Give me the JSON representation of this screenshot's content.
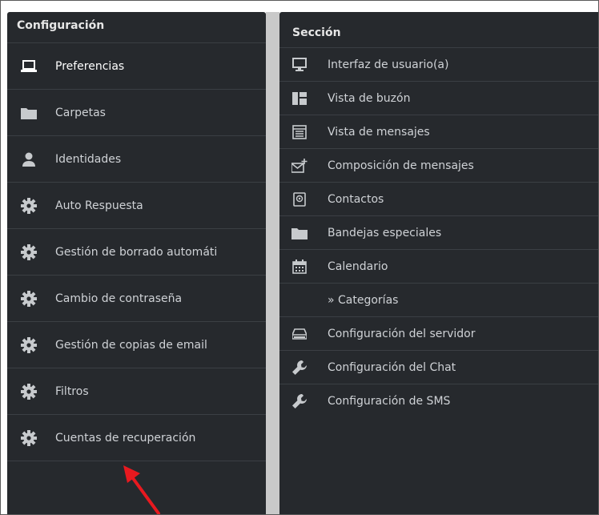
{
  "left": {
    "title": "Configuración",
    "items": [
      {
        "label": "Preferencias",
        "icon": "laptop-icon"
      },
      {
        "label": "Carpetas",
        "icon": "folder-icon"
      },
      {
        "label": "Identidades",
        "icon": "user-icon"
      },
      {
        "label": "Auto Respuesta",
        "icon": "gear-icon"
      },
      {
        "label": "Gestión de borrado automáti",
        "icon": "gear-icon"
      },
      {
        "label": "Cambio de contraseña",
        "icon": "gear-icon"
      },
      {
        "label": "Gestión de copias de email",
        "icon": "gear-icon"
      },
      {
        "label": "Filtros",
        "icon": "gear-icon"
      },
      {
        "label": "Cuentas de recuperación",
        "icon": "gear-icon"
      }
    ]
  },
  "right": {
    "title": "Sección",
    "items": [
      {
        "label": "Interfaz de usuario(a)",
        "icon": "monitor-icon"
      },
      {
        "label": "Vista de buzón",
        "icon": "layout-icon"
      },
      {
        "label": "Vista de mensajes",
        "icon": "message-view-icon"
      },
      {
        "label": "Composición de mensajes",
        "icon": "compose-icon"
      },
      {
        "label": "Contactos",
        "icon": "contacts-icon"
      },
      {
        "label": "Bandejas especiales",
        "icon": "folder-icon"
      },
      {
        "label": "Calendario",
        "icon": "calendar-icon"
      },
      {
        "label": "» Categorías",
        "icon": ""
      },
      {
        "label": "Configuración del servidor",
        "icon": "server-icon"
      },
      {
        "label": "Configuración del Chat",
        "icon": "wrench-icon"
      },
      {
        "label": "Configuración de SMS",
        "icon": "wrench-icon"
      }
    ]
  },
  "colors": {
    "panel": "#26292d",
    "annotation_arrow": "#e8191f"
  }
}
